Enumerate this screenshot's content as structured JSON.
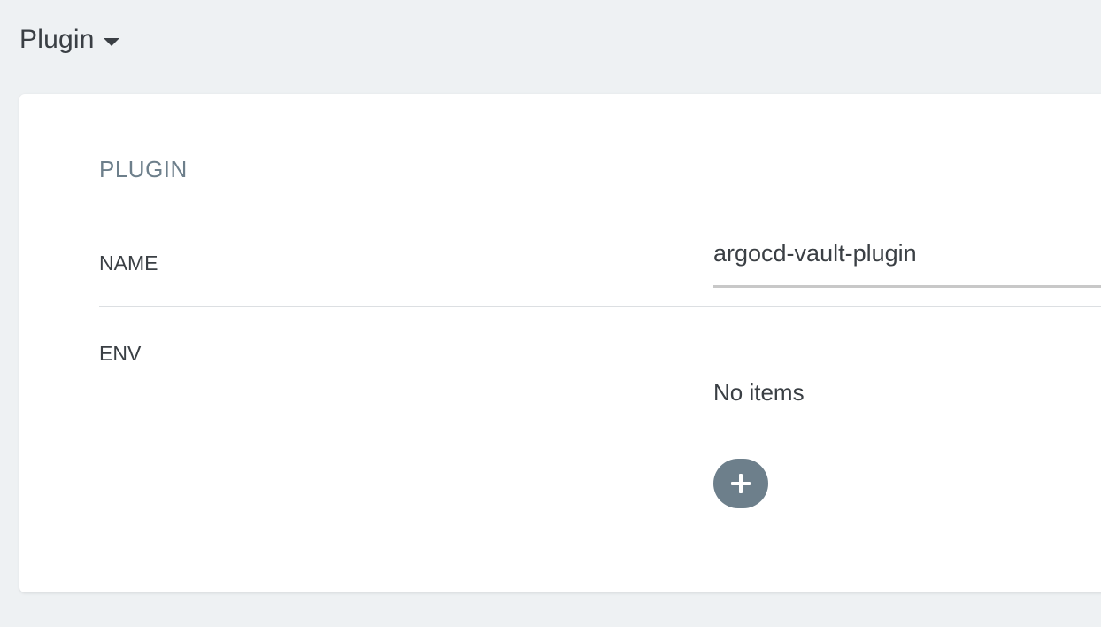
{
  "section": {
    "title": "Plugin"
  },
  "card": {
    "heading": "PLUGIN",
    "fields": {
      "name": {
        "label": "NAME",
        "value": "argocd-vault-plugin"
      },
      "env": {
        "label": "ENV",
        "empty_text": "No items"
      }
    }
  },
  "icons": {
    "caret": "caret-down-icon",
    "add": "plus-icon"
  },
  "colors": {
    "background": "#eef1f3",
    "card": "#ffffff",
    "muted": "#6d7f8b",
    "text": "#3a3f44"
  }
}
